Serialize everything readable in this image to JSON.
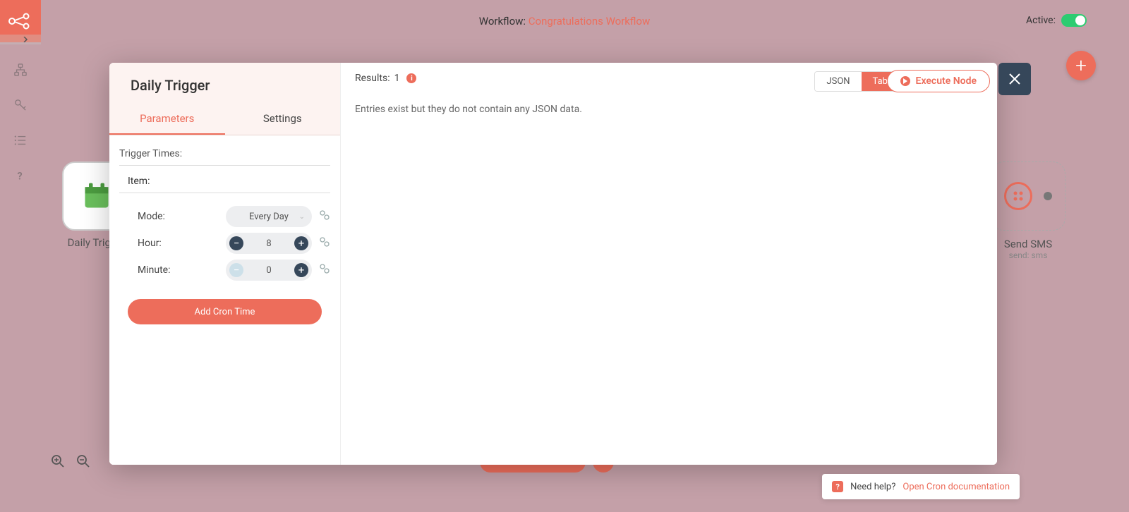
{
  "header": {
    "workflow_label": "Workflow:",
    "workflow_name": "Congratulations Workflow",
    "active_label": "Active:"
  },
  "modal": {
    "title": "Daily Trigger",
    "tabs": {
      "parameters": "Parameters",
      "settings": "Settings"
    },
    "trigger_times_label": "Trigger Times:",
    "item_label": "Item:",
    "mode_label": "Mode:",
    "mode_value": "Every Day",
    "hour_label": "Hour:",
    "hour_value": "8",
    "minute_label": "Minute:",
    "minute_value": "0",
    "add_cron_button": "Add Cron Time",
    "results_label": "Results:",
    "results_count": "1",
    "view_json": "JSON",
    "view_table": "Table",
    "execute_button": "Execute Node",
    "no_data_msg": "Entries exist but they do not contain any JSON data."
  },
  "canvas": {
    "left_node": "Daily Trigger",
    "right_node": "Send SMS",
    "right_sub": "send: sms"
  },
  "help": {
    "label": "Need help?",
    "link": "Open Cron documentation"
  }
}
